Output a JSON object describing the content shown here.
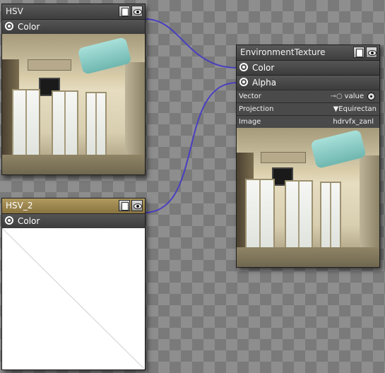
{
  "nodes": {
    "hsv": {
      "title": "HSV",
      "outputs": [
        {
          "label": "Color"
        }
      ]
    },
    "hsv2": {
      "title": "HSV_2",
      "outputs": [
        {
          "label": "Color"
        }
      ]
    },
    "env": {
      "title": "EnvironmentTexture",
      "outputs": [
        {
          "label": "Color"
        },
        {
          "label": "Alpha"
        }
      ],
      "props": [
        {
          "key": "Vector",
          "value": "value"
        },
        {
          "key": "Projection",
          "value": "▼Equirectan"
        },
        {
          "key": "Image",
          "value": "hdrvfx_zanl"
        }
      ]
    }
  },
  "colors": {
    "wire": "#4a3fc0",
    "title_gold": "#a08a55",
    "node_bg": "#3a3a3a"
  },
  "icons": {
    "title_buttons": [
      "document-icon",
      "eye-icon"
    ],
    "socket": "socket-ring-icon",
    "vector_key": "key-icon",
    "vector_input": "input-dot-icon"
  }
}
